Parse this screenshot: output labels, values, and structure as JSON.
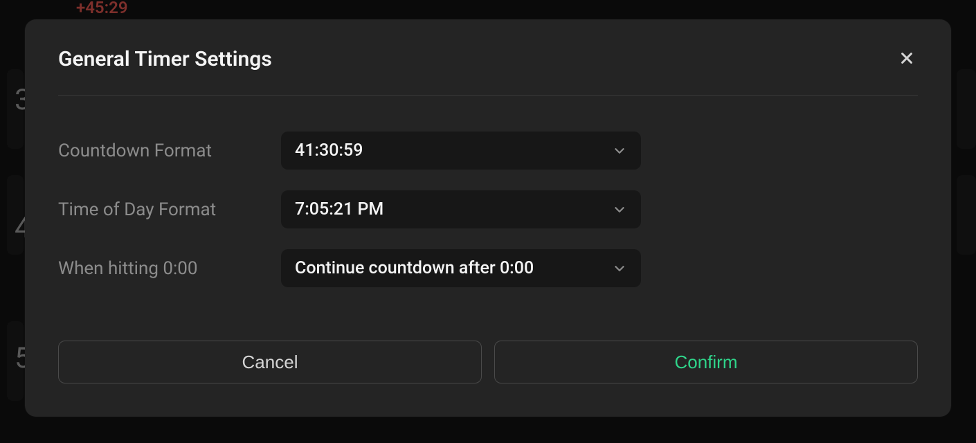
{
  "background": {
    "top_red_time": "+45:29",
    "row_numbers": [
      "3",
      "4",
      "5"
    ]
  },
  "modal": {
    "title": "General Timer Settings",
    "close_icon": "close-x",
    "fields": {
      "countdown_format": {
        "label": "Countdown Format",
        "value": "41:30:59"
      },
      "time_of_day_format": {
        "label": "Time of Day Format",
        "value": "7:05:21 PM"
      },
      "when_hitting_zero": {
        "label": "When hitting 0:00",
        "value": "Continue countdown after 0:00"
      }
    },
    "buttons": {
      "cancel": "Cancel",
      "confirm": "Confirm"
    }
  }
}
